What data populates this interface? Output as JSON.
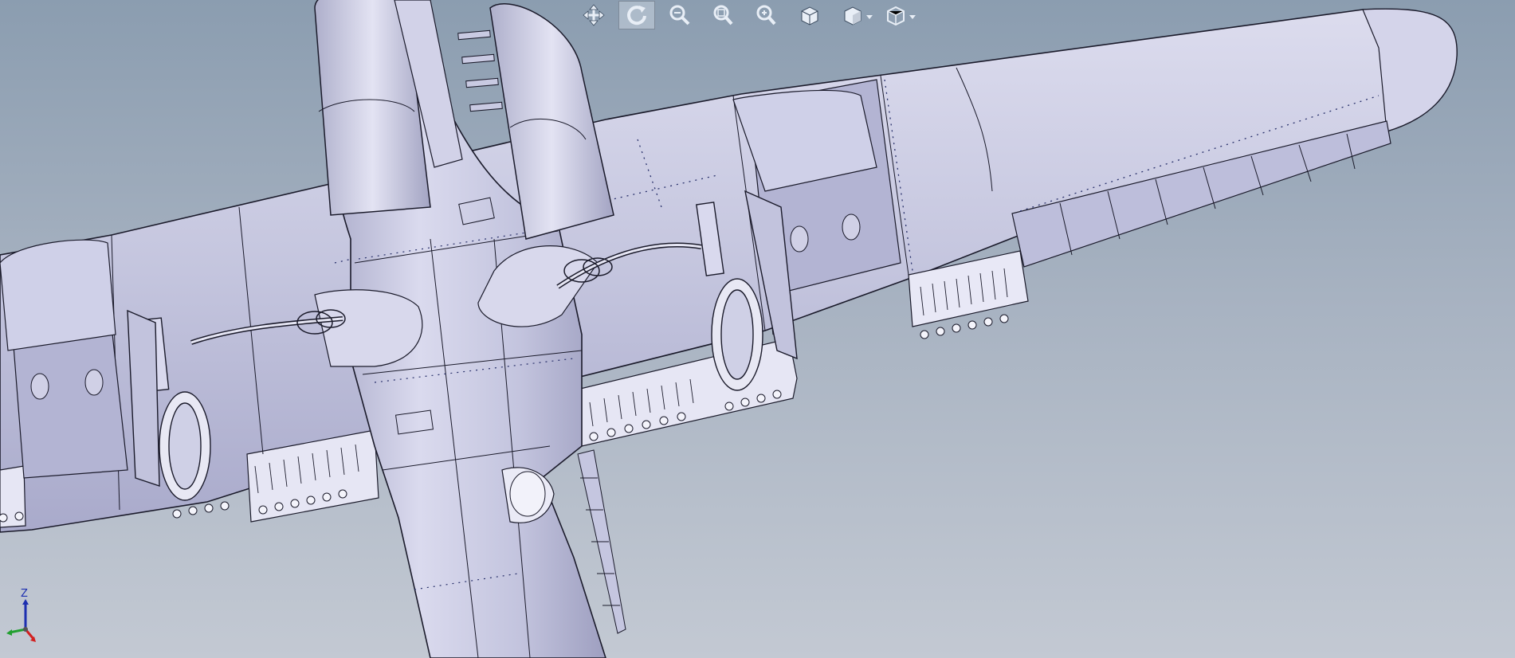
{
  "toolbar": {
    "buttons": [
      {
        "name": "pan-icon",
        "active": false
      },
      {
        "name": "rotate-icon",
        "active": true
      },
      {
        "name": "zoom-to-fit-icon",
        "active": false
      },
      {
        "name": "zoom-to-area-icon",
        "active": false
      },
      {
        "name": "zoom-in-out-icon",
        "active": false
      },
      {
        "name": "standard-views-icon",
        "active": false
      },
      {
        "name": "display-style-icon",
        "active": false,
        "dropdown": true
      },
      {
        "name": "view-orientation-icon",
        "active": false,
        "dropdown": true
      }
    ]
  },
  "triad": {
    "z_label": "Z",
    "colors": {
      "x": "#d22020",
      "y": "#22a030",
      "z": "#1d2fb0"
    }
  },
  "viewport": {
    "background_top": "#8b9db0",
    "background_bottom": "#c3c9d3",
    "model_fill": "#c7c8e0",
    "model_line": "#1a1a2a",
    "rivet_line": "#28306a"
  }
}
